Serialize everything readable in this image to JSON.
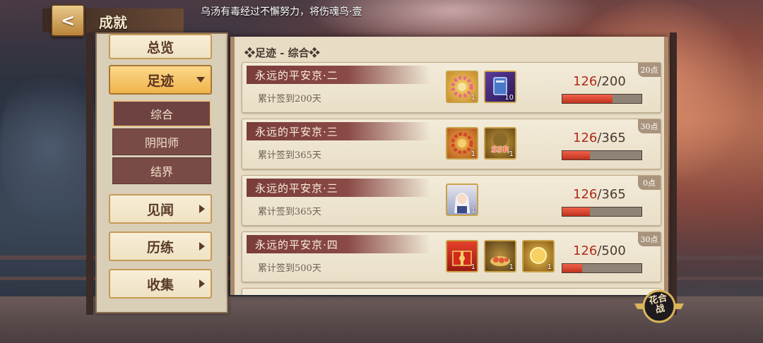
{
  "header": {
    "back_label": "<",
    "title": "成就",
    "marquee": "乌汤有毒经过不懈努力，将伤魂鸟·壹"
  },
  "sidebar": {
    "items": [
      {
        "label": "总览",
        "active": false
      },
      {
        "label": "足迹",
        "active": true
      },
      {
        "label": "见闻",
        "active": false
      },
      {
        "label": "历练",
        "active": false
      },
      {
        "label": "收集",
        "active": false
      }
    ],
    "subitems": [
      {
        "label": "综合",
        "selected": true
      },
      {
        "label": "阴阳师",
        "selected": false
      },
      {
        "label": "结界",
        "selected": false
      }
    ]
  },
  "main": {
    "section_title": "❖足迹 - 综合❖",
    "rows": [
      {
        "name": "永远的平安京·二",
        "desc": "累计签到200天",
        "points": "20点",
        "progress_current": "126",
        "progress_total": "/200",
        "progress_fraction": 0.63,
        "rewards": [
          {
            "icon": "flower-wreath-icon",
            "count": "1"
          },
          {
            "icon": "blue-ticket-icon",
            "count": "10"
          }
        ]
      },
      {
        "name": "永远的平安京·三",
        "desc": "累计签到365天",
        "points": "30点",
        "progress_current": "126",
        "progress_total": "/365",
        "progress_fraction": 0.345,
        "rewards": [
          {
            "icon": "autumn-wreath-icon",
            "count": "1"
          },
          {
            "icon": "ssr-card-icon",
            "count": "1"
          }
        ]
      },
      {
        "name": "永远的平安京·三",
        "desc": "累计签到365天",
        "points": "0点",
        "progress_current": "126",
        "progress_total": "/365",
        "progress_fraction": 0.345,
        "rewards": [
          {
            "icon": "character-portrait-icon",
            "count": "1"
          }
        ]
      },
      {
        "name": "永远的平安京·四",
        "desc": "累计签到500天",
        "points": "30点",
        "progress_current": "126",
        "progress_total": "/500",
        "progress_fraction": 0.252,
        "rewards": [
          {
            "icon": "gift-box-icon",
            "count": "1"
          },
          {
            "icon": "gold-sushi-icon",
            "count": "1"
          },
          {
            "icon": "gold-orb-icon",
            "count": "1"
          }
        ]
      }
    ]
  },
  "corner_button": {
    "label": "花合战"
  },
  "colors": {
    "accent_red": "#b02a1a",
    "ribbon": "#7a3d3a",
    "active_nav": "#f0b44c"
  }
}
